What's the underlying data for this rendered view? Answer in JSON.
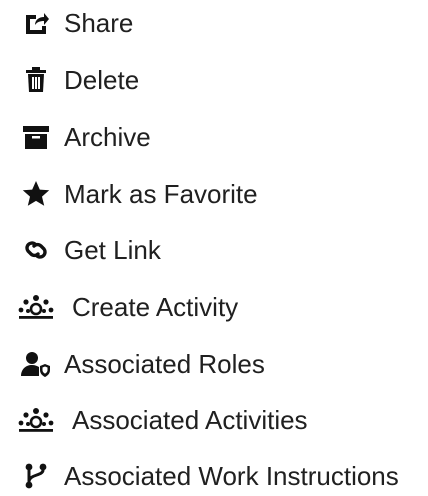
{
  "menu": {
    "items": [
      {
        "label": "Share",
        "icon": "share-icon"
      },
      {
        "label": "Delete",
        "icon": "trash-icon"
      },
      {
        "label": "Archive",
        "icon": "archive-icon"
      },
      {
        "label": "Mark as Favorite",
        "icon": "star-icon"
      },
      {
        "label": "Get Link",
        "icon": "link-icon"
      },
      {
        "label": "Create Activity",
        "icon": "activity-icon"
      },
      {
        "label": "Associated Roles",
        "icon": "user-role-icon"
      },
      {
        "label": "Associated Activities",
        "icon": "activity-icon"
      },
      {
        "label": "Associated Work Instructions",
        "icon": "branch-icon"
      }
    ]
  },
  "colors": {
    "icon": "#111111",
    "text": "#202020",
    "background": "#ffffff"
  }
}
